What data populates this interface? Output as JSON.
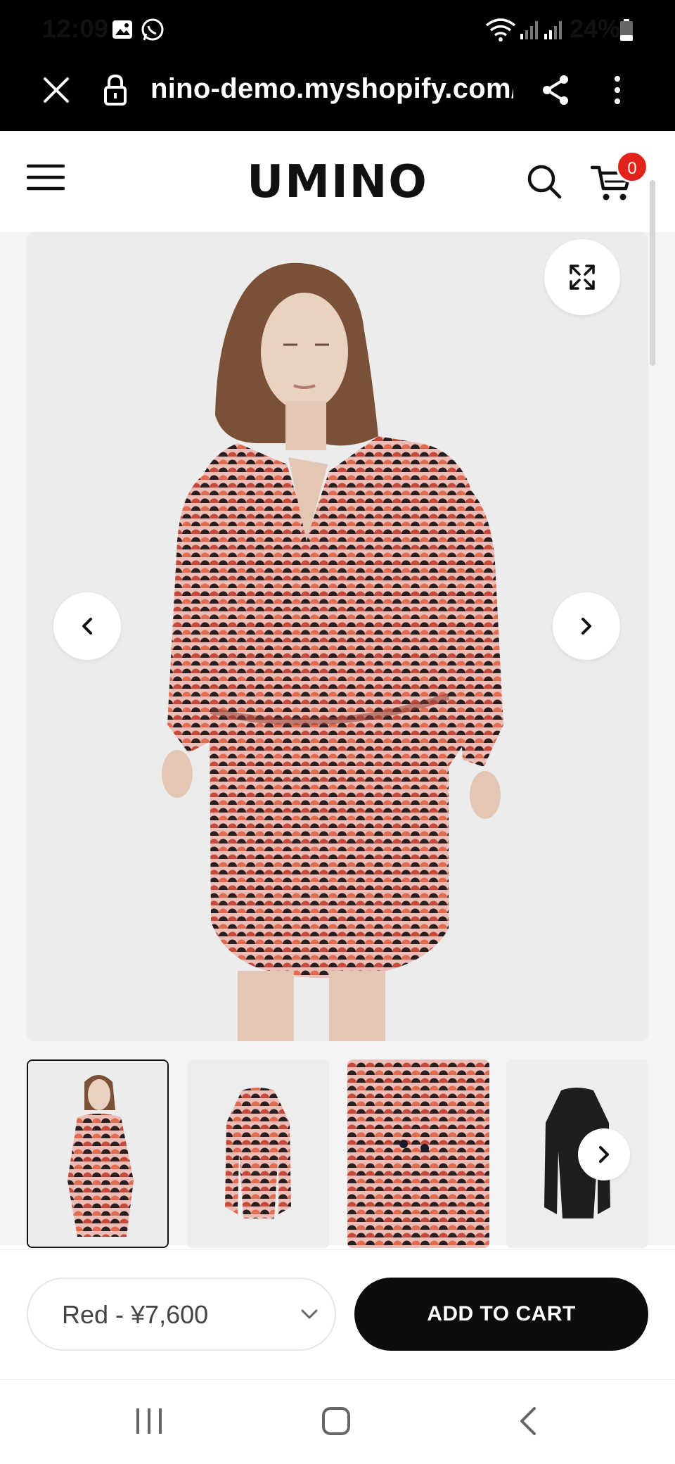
{
  "status_bar": {
    "time": "12:09",
    "battery_percent": "24%",
    "icons": [
      "gallery-icon",
      "whatsapp-icon",
      "wifi-icon",
      "signal-icon",
      "signal-icon",
      "battery-icon"
    ]
  },
  "browser": {
    "url": "nino-demo.myshopify.com/e",
    "icons": [
      "close-icon",
      "lock-icon",
      "share-icon",
      "more-vert-icon"
    ]
  },
  "header": {
    "logo": "UMINO",
    "cart_count": "0",
    "icons": [
      "menu-icon",
      "search-icon",
      "cart-icon"
    ]
  },
  "gallery": {
    "image_description": "Model wearing red geometric print wrap dress",
    "thumbnails": [
      {
        "name": "model-front"
      },
      {
        "name": "dress-flat"
      },
      {
        "name": "fabric-detail"
      },
      {
        "name": "black-variant"
      }
    ],
    "icons": [
      "expand-icon",
      "chevron-left-icon",
      "chevron-right-icon"
    ]
  },
  "purchase": {
    "variant": "Red - ¥7,600",
    "add_to_cart": "ADD TO CART"
  },
  "colors": {
    "accent": "#e2231a",
    "button": "#0d0d0d",
    "print_red": "#c64a3a",
    "print_pink": "#e9b2b0",
    "print_black": "#2a1e1e"
  }
}
